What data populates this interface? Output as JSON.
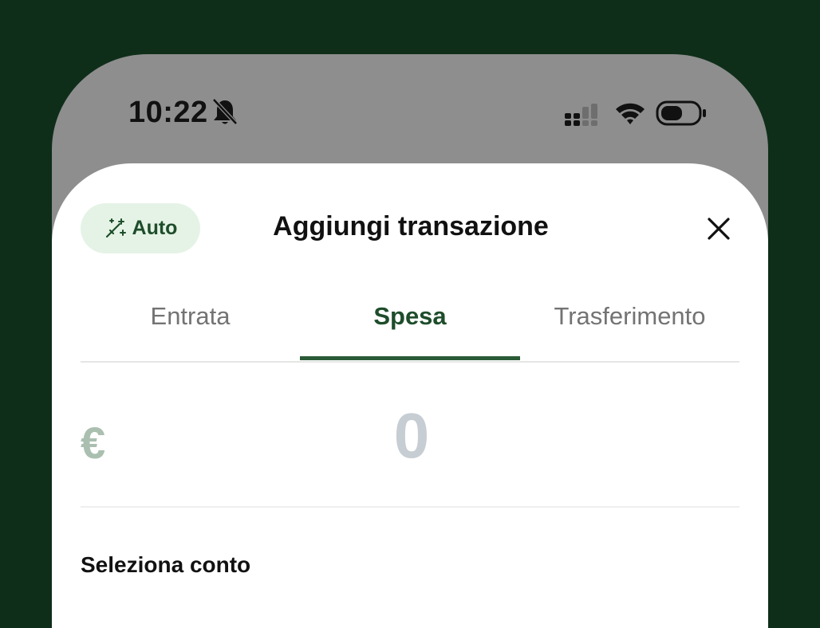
{
  "status_bar": {
    "time": "10:22",
    "icons": [
      "bell-slash-icon",
      "signal-icon",
      "wifi-icon",
      "battery-icon"
    ]
  },
  "sheet": {
    "auto_button": {
      "label": "Auto",
      "icon": "magic-wand-icon"
    },
    "title": "Aggiungi transazione",
    "close_icon": "close-icon",
    "tabs": [
      {
        "label": "Entrata",
        "active": false
      },
      {
        "label": "Spesa",
        "active": true
      },
      {
        "label": "Trasferimento",
        "active": false
      }
    ],
    "amount": {
      "currency": "€",
      "value": "0"
    },
    "select_account_label": "Seleziona conto"
  },
  "colors": {
    "background": "#0f2e1a",
    "accent": "#1e4d2b",
    "auto_bg": "#e5f3e6",
    "placeholder": "#c6cdd3"
  }
}
